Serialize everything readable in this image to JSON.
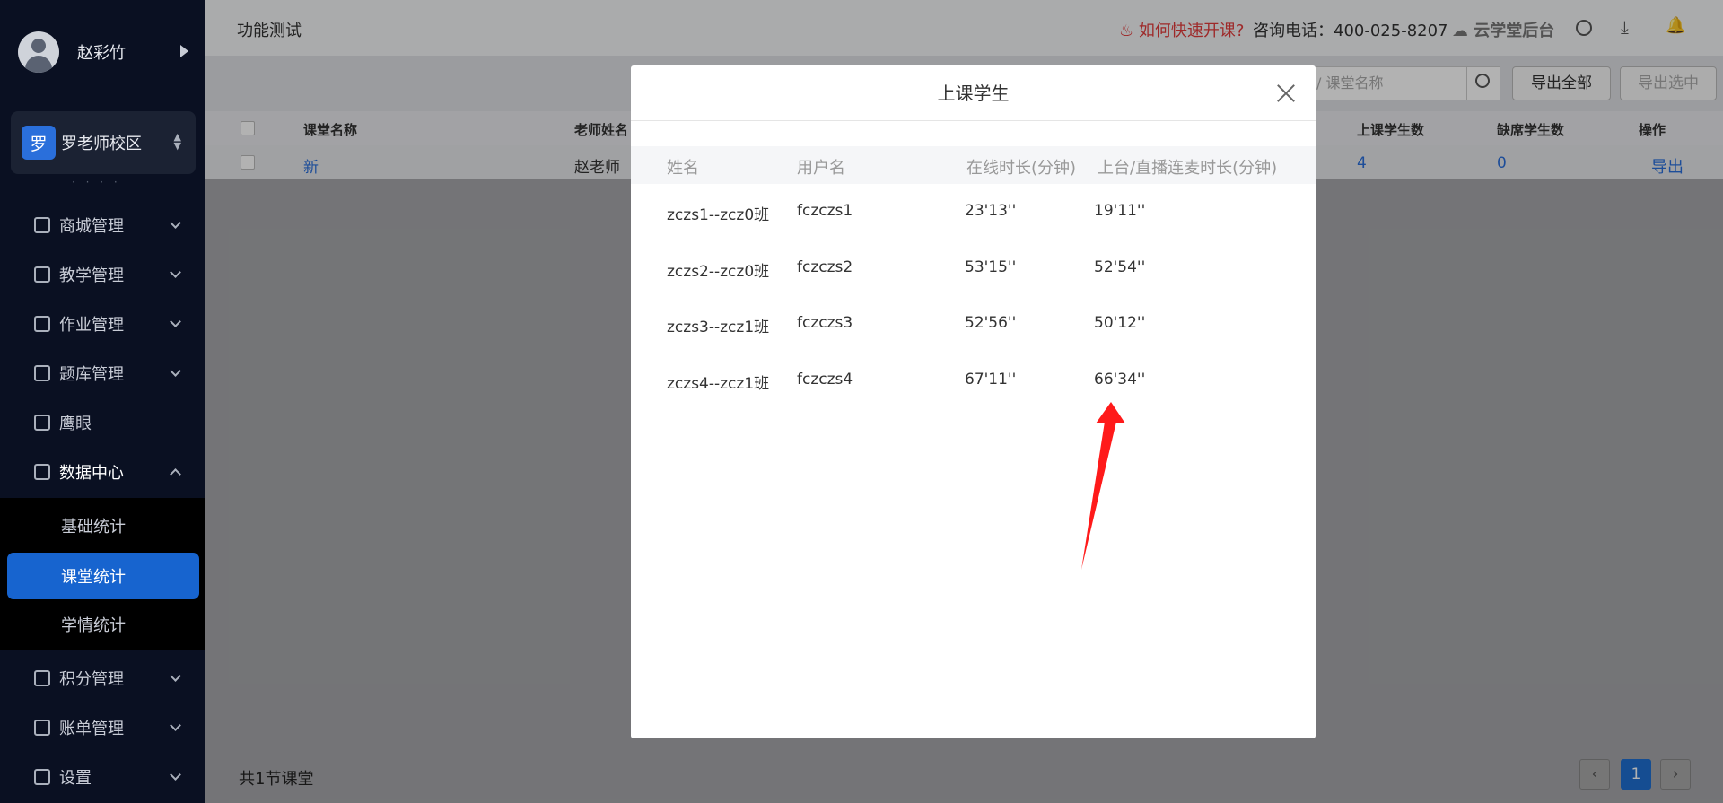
{
  "sidebar": {
    "user_name": "赵彩竹",
    "campus_badge": "罗",
    "campus_name": "罗老师校区",
    "menu": [
      {
        "label": "商城管理"
      },
      {
        "label": "教学管理"
      },
      {
        "label": "作业管理"
      },
      {
        "label": "题库管理"
      },
      {
        "label": "鹰眼"
      },
      {
        "label": "数据中心"
      },
      {
        "label": "积分管理"
      },
      {
        "label": "账单管理"
      },
      {
        "label": "设置"
      }
    ],
    "submenu": [
      {
        "label": "基础统计"
      },
      {
        "label": "课堂统计"
      },
      {
        "label": "学情统计"
      }
    ]
  },
  "topbar": {
    "title": "功能测试",
    "hint": "如何快速开课?",
    "phone": "咨询电话：400-025-8207",
    "brand": "云学堂后台"
  },
  "toolbar": {
    "search_placeholder": "/ 课堂名称",
    "export_all": "导出全部",
    "export_selected": "导出选中"
  },
  "table": {
    "headers": {
      "class_name": "课堂名称",
      "teacher": "老师姓名",
      "attend": "上课学生数",
      "absent": "缺席学生数",
      "action": "操作"
    },
    "row": {
      "class_name": "新",
      "teacher": "赵老师",
      "attend": "4",
      "absent": "0",
      "action": "导出"
    }
  },
  "footer": {
    "total": "共1节课堂",
    "page": "1"
  },
  "modal": {
    "title": "上课学生",
    "headers": [
      "姓名",
      "用户名",
      "在线时长(分钟)",
      "上台/直播连麦时长(分钟)"
    ],
    "rows": [
      [
        "zczs1--zcz0班",
        "fczczs1",
        "23'13''",
        "19'11''"
      ],
      [
        "zczs2--zcz0班",
        "fczczs2",
        "53'15''",
        "52'54''"
      ],
      [
        "zczs3--zcz1班",
        "fczczs3",
        "52'56''",
        "50'12''"
      ],
      [
        "zczs4--zcz1班",
        "fczczs4",
        "67'11''",
        "66'34''"
      ]
    ]
  }
}
